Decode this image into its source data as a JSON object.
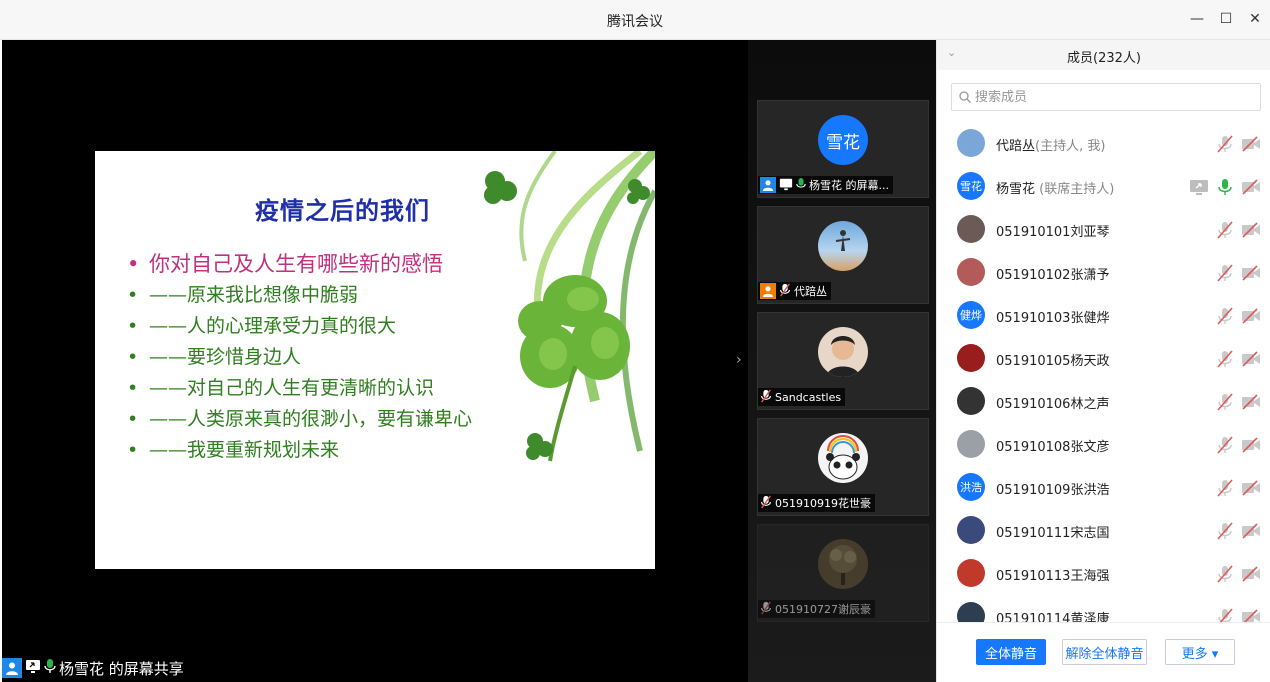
{
  "window": {
    "title": "腾讯会议",
    "minimize": "—",
    "maximize": "☐",
    "close": "✕"
  },
  "slide": {
    "title": "疫情之后的我们",
    "bullets": [
      "你对自己及人生有哪些新的感悟",
      "——原来我比想像中脆弱",
      "——人的心理承受力真的很大",
      "——要珍惜身边人",
      "——对自己的人生有更清晰的认识",
      "——人类原来真的很渺小，要有谦卑心",
      "——我要重新规划未来"
    ],
    "bullet_glyph": "•"
  },
  "share_label": "杨雪花 的屏幕共享",
  "collapse_arrow": "›",
  "tiles": [
    {
      "avatar_text": "雪花",
      "label": "杨雪花 的屏幕..."
    },
    {
      "avatar_text": "",
      "label": "代踣丛"
    },
    {
      "avatar_text": "",
      "label": "Sandcastles"
    },
    {
      "avatar_text": "",
      "label": "051910919花世豪"
    },
    {
      "avatar_text": "",
      "label": "051910727谢辰豪"
    }
  ],
  "panel": {
    "title": "成员(232人)",
    "chevron": "⌄",
    "search_placeholder": "搜索成员",
    "members": [
      {
        "name": "代踣丛",
        "role": "(主持人, 我)",
        "avatar_text": "",
        "color": "#7aa7d8"
      },
      {
        "name": "杨雪花",
        "role": " (联席主持人)",
        "avatar_text": "雪花",
        "color": "#1677ff"
      },
      {
        "name": "051910101刘亚琴",
        "role": "",
        "avatar_text": "",
        "color": "#6b5a55"
      },
      {
        "name": "051910102张潇予",
        "role": "",
        "avatar_text": "",
        "color": "#b35a5a"
      },
      {
        "name": "051910103张健烨",
        "role": "",
        "avatar_text": "健烨",
        "color": "#1677ff"
      },
      {
        "name": "051910105杨天政",
        "role": "",
        "avatar_text": "",
        "color": "#9a1d1d"
      },
      {
        "name": "051910106林之声",
        "role": "",
        "avatar_text": "",
        "color": "#333333"
      },
      {
        "name": "051910108张文彦",
        "role": "",
        "avatar_text": "",
        "color": "#9aa0a6"
      },
      {
        "name": "051910109张洪浩",
        "role": "",
        "avatar_text": "洪浩",
        "color": "#1677ff"
      },
      {
        "name": "051910111宋志国",
        "role": "",
        "avatar_text": "",
        "color": "#3a4a7a"
      },
      {
        "name": "051910113王海强",
        "role": "",
        "avatar_text": "",
        "color": "#c0392b"
      },
      {
        "name": "051910114黄泽康",
        "role": "",
        "avatar_text": "",
        "color": "#2c3e50"
      }
    ],
    "mute_all": "全体静音",
    "unmute_all": "解除全体静音",
    "more": "更多 ▾"
  },
  "colors": {
    "accent": "#1677ff",
    "mic_on": "#2bb44a",
    "muted": "#e05a5a"
  }
}
